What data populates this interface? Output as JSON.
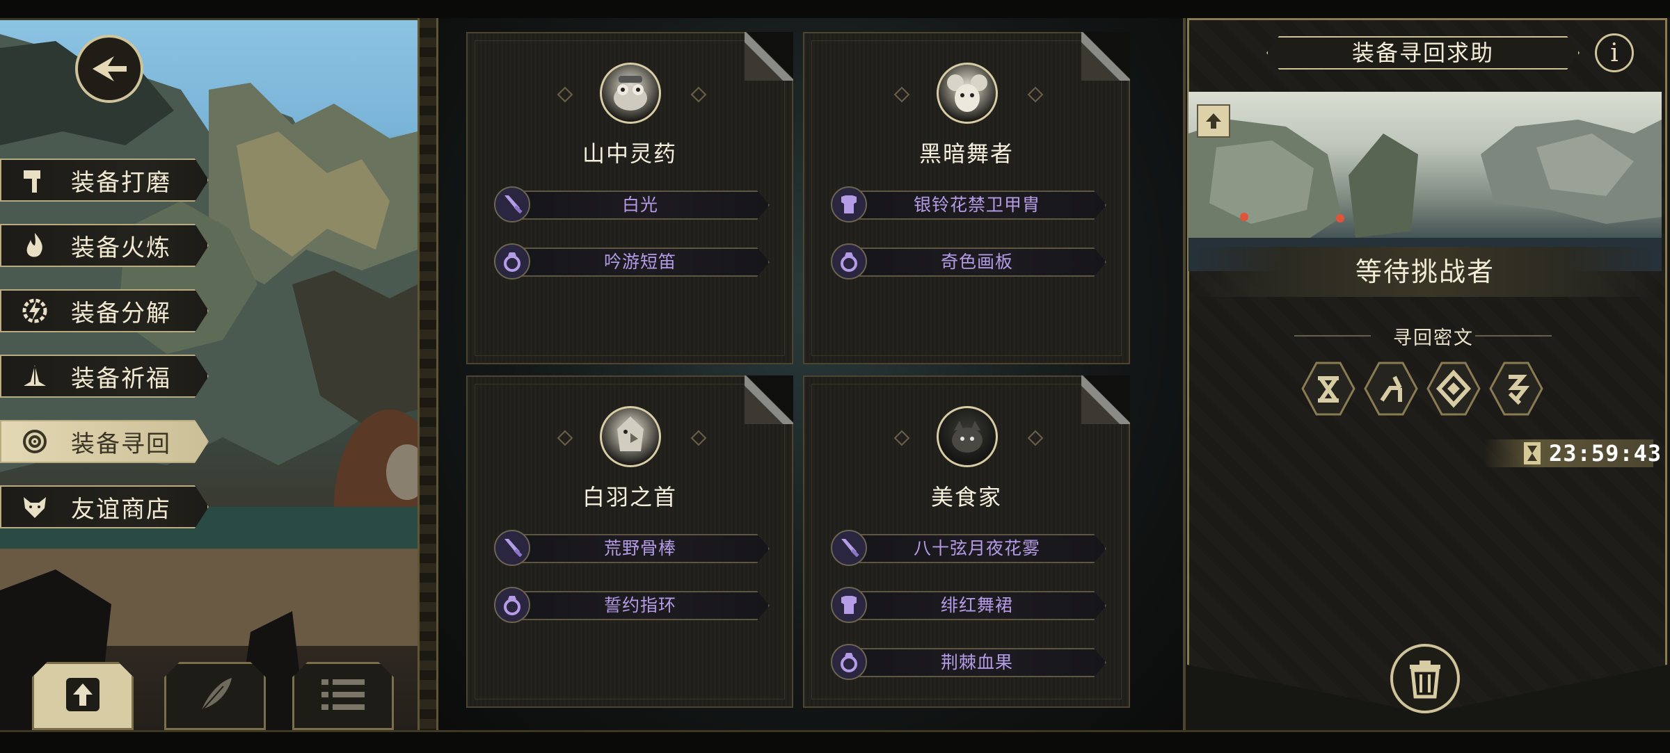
{
  "window": {
    "width": 2400,
    "height": 1080
  },
  "colors": {
    "accent_gold": "#cfc39a",
    "equip_text": "#b49ce6",
    "panel_bg": "#161613",
    "selected_menu": "#d8cca5"
  },
  "nav": {
    "back_icon": "back-arrow-icon"
  },
  "side_menu": [
    {
      "label": "装备打磨",
      "icon": "hammer-icon",
      "selected": false
    },
    {
      "label": "装备火炼",
      "icon": "flame-icon",
      "selected": false
    },
    {
      "label": "装备分解",
      "icon": "gear-bolt-icon",
      "selected": false
    },
    {
      "label": "装备祈福",
      "icon": "praying-hands-icon",
      "selected": false
    },
    {
      "label": "装备寻回",
      "icon": "target-icon",
      "selected": true
    },
    {
      "label": "友谊商店",
      "icon": "fox-icon",
      "selected": false
    }
  ],
  "bottom_tabs": [
    {
      "icon": "upload-icon",
      "active": true
    },
    {
      "icon": "feather-icon",
      "active": false
    },
    {
      "icon": "list-icon",
      "active": false
    }
  ],
  "cards": [
    {
      "name": "山中灵药",
      "avatar": "frog-avatar",
      "equipment": [
        {
          "type": "weapon",
          "icon": "sword-icon",
          "label": "白光"
        },
        {
          "type": "ring",
          "icon": "ring-icon",
          "label": "吟游短笛"
        }
      ]
    },
    {
      "name": "黑暗舞者",
      "avatar": "mouse-avatar",
      "equipment": [
        {
          "type": "armor",
          "icon": "armor-icon",
          "label": "银铃花禁卫甲胄"
        },
        {
          "type": "ring",
          "icon": "ring-icon",
          "label": "奇色画板"
        }
      ]
    },
    {
      "name": "白羽之首",
      "avatar": "bird-avatar",
      "equipment": [
        {
          "type": "weapon",
          "icon": "sword-icon",
          "label": "荒野骨棒"
        },
        {
          "type": "ring",
          "icon": "ring-icon",
          "label": "誓约指环"
        }
      ]
    },
    {
      "name": "美食家",
      "avatar": "beast-avatar",
      "equipment": [
        {
          "type": "weapon",
          "icon": "sword-icon",
          "label": "八十弦月夜花雾"
        },
        {
          "type": "armor",
          "icon": "armor-icon",
          "label": "绯红舞裙"
        },
        {
          "type": "ring",
          "icon": "ring-icon",
          "label": "荆棘血果"
        }
      ]
    }
  ],
  "panel": {
    "title": "装备寻回求助",
    "info_icon": "i",
    "stage_status": "等待挑战者",
    "cipher_label": "寻回密文",
    "runes": [
      "rune-1-icon",
      "rune-2-icon",
      "rune-3-icon",
      "rune-4-icon"
    ],
    "timer": "23:59:43",
    "trash_icon": "trash-icon"
  }
}
